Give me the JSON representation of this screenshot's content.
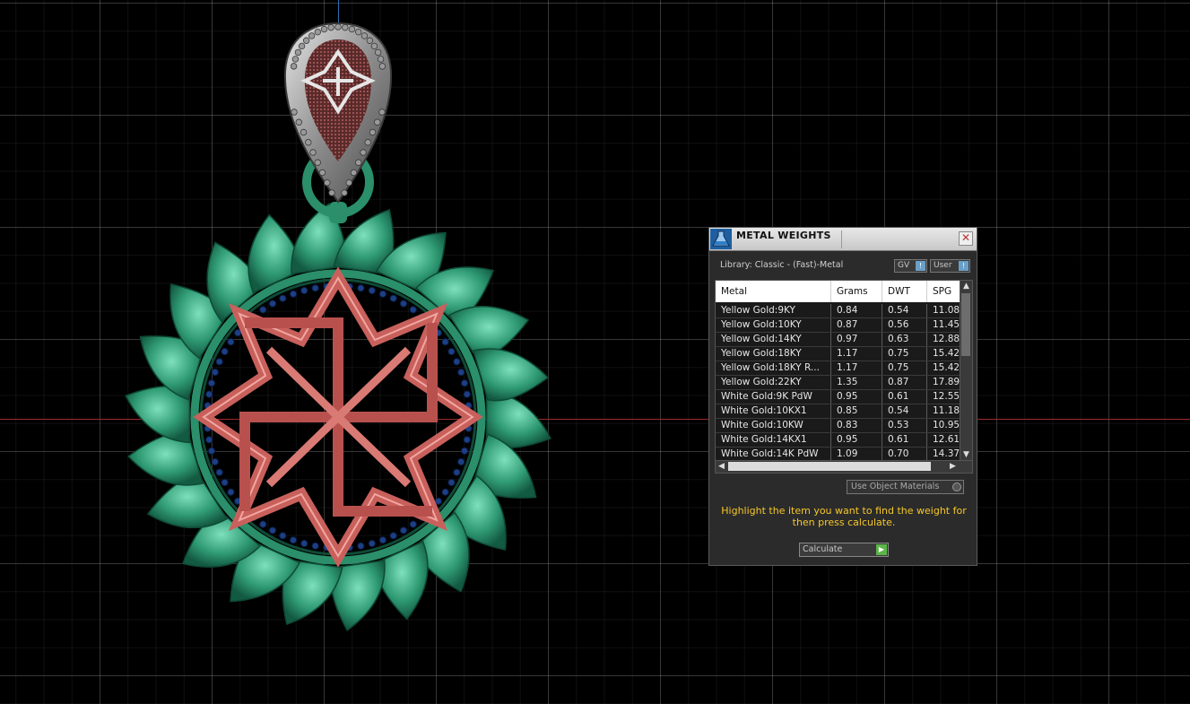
{
  "panel": {
    "title": "METAL WEIGHTS",
    "close_symbol": "✕",
    "library_label": "Library: Classic - (Fast)-Metal",
    "gv_label": "GV",
    "user_label": "User",
    "columns": [
      "Metal",
      "Grams",
      "DWT",
      "SPG"
    ],
    "rows": [
      {
        "metal": "Yellow Gold:9KY",
        "grams": "0.84",
        "dwt": "0.54",
        "spg": "11.08"
      },
      {
        "metal": "Yellow Gold:10KY",
        "grams": "0.87",
        "dwt": "0.56",
        "spg": "11.45"
      },
      {
        "metal": "Yellow Gold:14KY",
        "grams": "0.97",
        "dwt": "0.63",
        "spg": "12.88"
      },
      {
        "metal": "Yellow Gold:18KY",
        "grams": "1.17",
        "dwt": "0.75",
        "spg": "15.42"
      },
      {
        "metal": "Yellow Gold:18KY R...",
        "grams": "1.17",
        "dwt": "0.75",
        "spg": "15.42"
      },
      {
        "metal": "Yellow Gold:22KY",
        "grams": "1.35",
        "dwt": "0.87",
        "spg": "17.89"
      },
      {
        "metal": "White Gold:9K PdW",
        "grams": "0.95",
        "dwt": "0.61",
        "spg": "12.55"
      },
      {
        "metal": "White Gold:10KX1",
        "grams": "0.85",
        "dwt": "0.54",
        "spg": "11.18"
      },
      {
        "metal": "White Gold:10KW",
        "grams": "0.83",
        "dwt": "0.53",
        "spg": "10.95"
      },
      {
        "metal": "White Gold:14KX1",
        "grams": "0.95",
        "dwt": "0.61",
        "spg": "12.61"
      },
      {
        "metal": "White Gold:14K PdW",
        "grams": "1.09",
        "dwt": "0.70",
        "spg": "14.37"
      }
    ],
    "use_object_materials": "Use Object Materials",
    "hint": "Highlight the item you want to find the weight for then press calculate.",
    "calculate_label": "Calculate"
  },
  "colors": {
    "viewport_bg": "#000000",
    "x_axis": "#9b2a2a",
    "y_axis": "#2f6fb0",
    "pendant_green": "#2f9a74",
    "pendant_red": "#c8605c",
    "bead_blue": "#1d3f86",
    "bail_silver": "#a8a8a8",
    "hint_yellow": "#f5c72a"
  },
  "icons": {
    "panel_logo": "flask-icon",
    "close": "close-icon",
    "calculate": "play-arrow-icon",
    "scroll_up": "arrow-up-icon",
    "scroll_down": "arrow-down-icon",
    "scroll_left": "arrow-left-icon",
    "scroll_right": "arrow-right-icon"
  }
}
